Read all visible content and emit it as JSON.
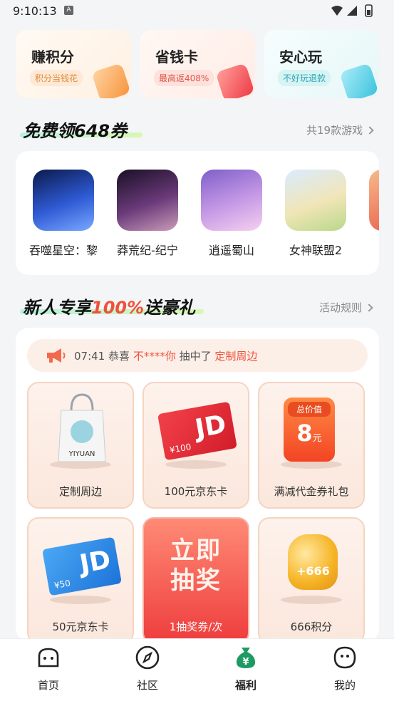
{
  "status_bar": {
    "time": "9:10:13",
    "notification_glyph": "A"
  },
  "top_cards": [
    {
      "title": "赚积分",
      "subtitle": "积分当钱花",
      "accent": "#f59a4a",
      "bg": "#fff7ee"
    },
    {
      "title": "省钱卡",
      "subtitle": "最高返408%",
      "accent": "#f0504a",
      "bg": "#fff1ee"
    },
    {
      "title": "安心玩",
      "subtitle": "不好玩退款",
      "accent": "#27b6c9",
      "bg": "#eefaf9"
    }
  ],
  "free_section": {
    "title_prefix": "免费领",
    "title_highlight": "648券",
    "link": "共19款游戏"
  },
  "games": [
    {
      "name": "吞噬星空：黎"
    },
    {
      "name": "莽荒纪-纪宁"
    },
    {
      "name": "逍遥蜀山"
    },
    {
      "name": "女神联盟2"
    },
    {
      "name": "..."
    }
  ],
  "newbie_section": {
    "title_prefix": "新人专享",
    "title_highlight": "100%",
    "title_suffix": "送豪礼",
    "link": "活动规则"
  },
  "ticker": {
    "time": "07:41",
    "text1": "恭喜",
    "user": "不****你",
    "text2": "抽中了",
    "prize": "定制周边"
  },
  "prizes": [
    {
      "label": "定制周边"
    },
    {
      "label": "100元京东卡",
      "card_text": "JD",
      "card_value": "¥100"
    },
    {
      "label": "满减代金券礼包",
      "coupon_head": "总价值",
      "coupon_value": "8",
      "coupon_unit": "元"
    },
    {
      "label": "50元京东卡",
      "card_text": "JD",
      "card_value": "¥50"
    },
    {
      "label": "1抽奖券/次",
      "big_line1": "立即",
      "big_line2": "抽奖"
    },
    {
      "label": "666积分",
      "badge": "+666"
    }
  ],
  "tabs": [
    {
      "label": "首页",
      "icon": "home-icon"
    },
    {
      "label": "社区",
      "icon": "compass-icon"
    },
    {
      "label": "福利",
      "icon": "money-bag-icon",
      "active": true
    },
    {
      "label": "我的",
      "icon": "profile-icon"
    }
  ],
  "colors": {
    "accent_red": "#f0503c",
    "active_green": "#1e9b64"
  }
}
